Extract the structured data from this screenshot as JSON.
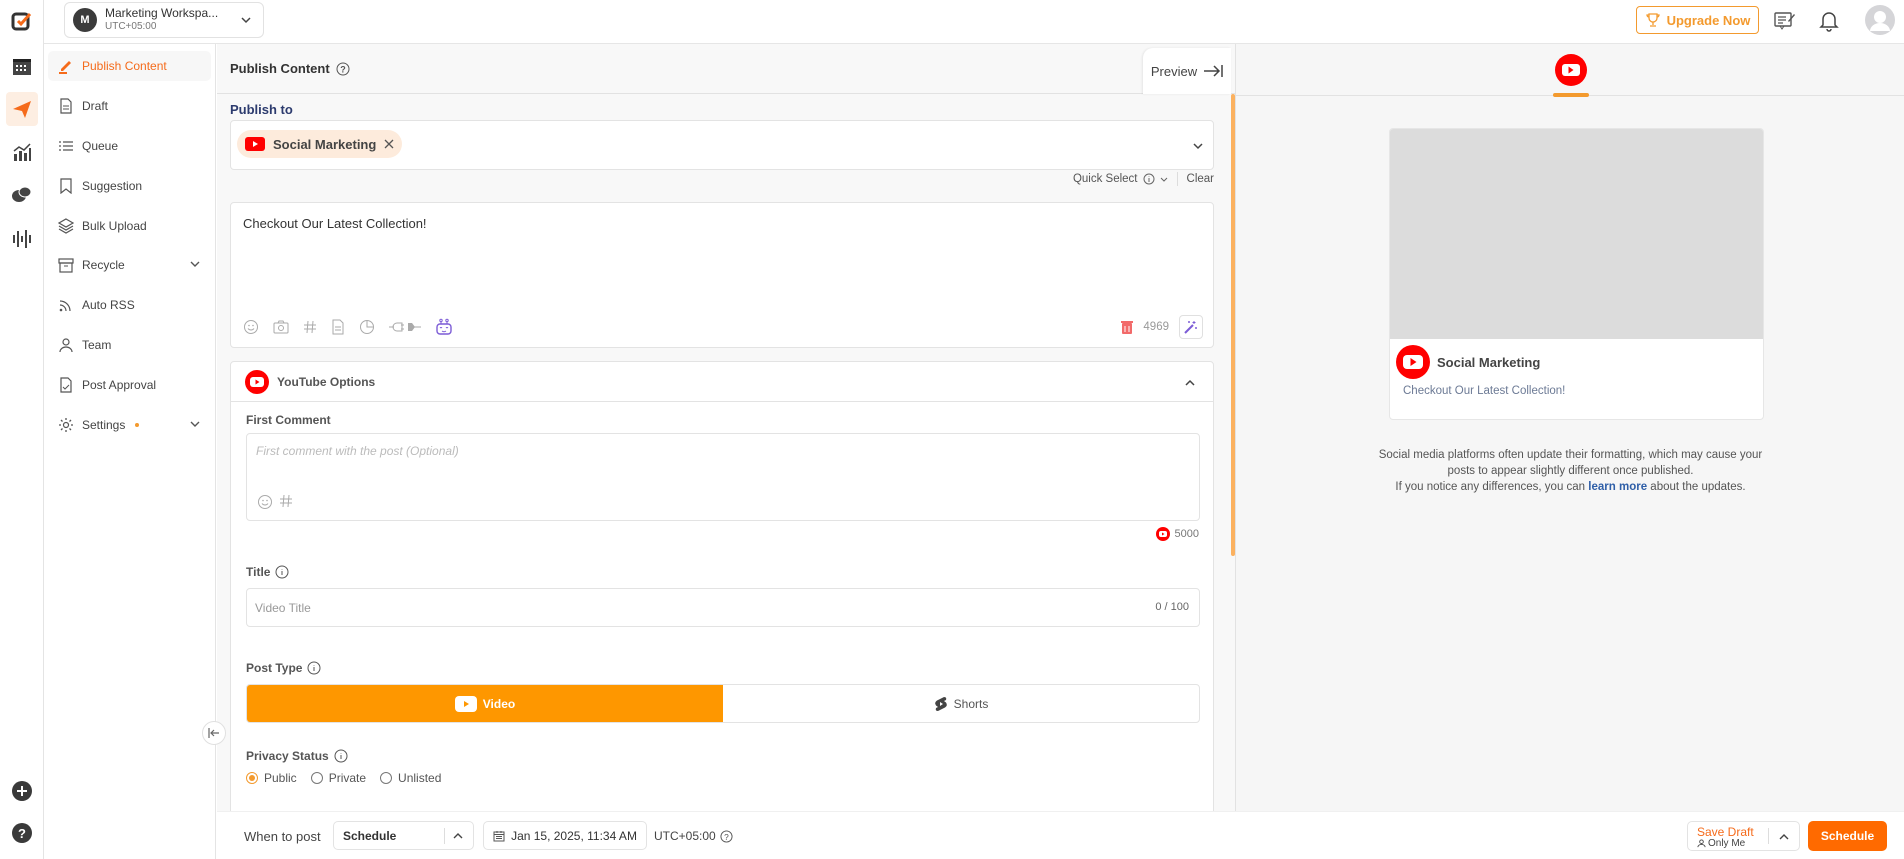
{
  "workspace": {
    "initial": "M",
    "name": "Marketing Workspa...",
    "timezone": "UTC+05:00"
  },
  "header": {
    "upgrade_label": "Upgrade Now"
  },
  "nav": {
    "items": [
      {
        "label": "Publish Content",
        "icon": "pencil-icon",
        "active": true
      },
      {
        "label": "Draft",
        "icon": "document-icon"
      },
      {
        "label": "Queue",
        "icon": "list-icon"
      },
      {
        "label": "Suggestion",
        "icon": "bookmark-icon"
      },
      {
        "label": "Bulk Upload",
        "icon": "layers-icon"
      },
      {
        "label": "Recycle",
        "icon": "archive-icon",
        "expandable": true
      },
      {
        "label": "Auto RSS",
        "icon": "rss-icon"
      },
      {
        "label": "Team",
        "icon": "user-icon"
      },
      {
        "label": "Post Approval",
        "icon": "file-check-icon"
      },
      {
        "label": "Settings",
        "icon": "gear-icon",
        "expandable": true,
        "badge_dot": true
      }
    ]
  },
  "main": {
    "title": "Publish Content",
    "preview_label": "Preview",
    "publish_to_label": "Publish to",
    "selected_account": "Social Marketing",
    "quick_select_label": "Quick Select",
    "clear_label": "Clear",
    "post_text": "Checkout Our Latest Collection!",
    "char_remaining": "4969",
    "youtube_options": {
      "title": "YouTube Options",
      "first_comment_label": "First Comment",
      "first_comment_placeholder": "First comment with the post (Optional)",
      "first_comment_limit": "5000",
      "title_label": "Title",
      "title_placeholder": "Video Title",
      "title_count": "0 / 100",
      "post_type_label": "Post Type",
      "post_types": [
        {
          "label": "Video",
          "selected": true
        },
        {
          "label": "Shorts",
          "selected": false
        }
      ],
      "privacy_label": "Privacy Status",
      "privacy_options": [
        {
          "label": "Public",
          "selected": true
        },
        {
          "label": "Private",
          "selected": false
        },
        {
          "label": "Unlisted",
          "selected": false
        }
      ]
    }
  },
  "preview": {
    "account_name": "Social Marketing",
    "caption": "Checkout Our Latest Collection!",
    "note_line1": "Social media platforms often update their formatting, which may cause your",
    "note_line2": "posts to appear slightly different once published.",
    "note_line3_pre": "If you notice any differences, you can",
    "note_link": "learn more",
    "note_line3_post": "about the updates."
  },
  "footer": {
    "when_label": "When to post",
    "when_value": "Schedule",
    "datetime": "Jan 15, 2025, 11:34 AM",
    "timezone": "UTC+05:00",
    "save_draft_label": "Save Draft",
    "visibility": "Only Me",
    "schedule_label": "Schedule"
  },
  "colors": {
    "accent": "#f56b1b",
    "orange": "#fe9700",
    "youtube_red": "#ff0000",
    "link": "#2f5fa8"
  }
}
